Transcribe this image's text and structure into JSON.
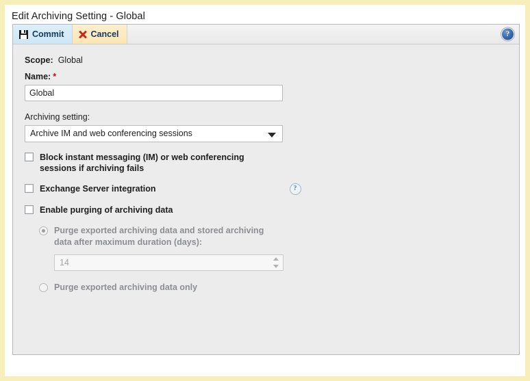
{
  "window": {
    "title": "Edit Archiving Setting - Global"
  },
  "toolbar": {
    "commit_label": "Commit",
    "cancel_label": "Cancel",
    "help_glyph": "?",
    "commit_icon": "save-icon",
    "cancel_icon": "close-x-icon"
  },
  "form": {
    "scope_label": "Scope:",
    "scope_value": "Global",
    "name_label": "Name:",
    "name_required_marker": "*",
    "name_value": "Global",
    "archiving_label": "Archiving setting:",
    "archiving_selected": "Archive IM and web conferencing sessions",
    "archiving_options": [
      "Archive IM and web conferencing sessions"
    ],
    "checkbox_block": {
      "label": "Block instant messaging (IM) or web conferencing sessions if archiving fails",
      "checked": false
    },
    "checkbox_exchange": {
      "label": "Exchange Server integration",
      "checked": false,
      "help_glyph": "?"
    },
    "checkbox_purging": {
      "label": "Enable purging of archiving data",
      "checked": false
    },
    "radio_purge_duration": {
      "label": "Purge exported archiving data and stored archiving data after maximum duration (days):",
      "selected": true,
      "disabled": true
    },
    "duration_input": {
      "value": "14",
      "disabled": true
    },
    "radio_purge_exported_only": {
      "label": "Purge exported archiving data only",
      "selected": false,
      "disabled": true
    }
  },
  "colors": {
    "frame": "#f7eeb9",
    "panel_bg": "#ececed",
    "commit_bg": "#cde7f8",
    "cancel_bg": "#fbe6b4",
    "toolbar_text": "#16385c",
    "required_star": "#d0021b",
    "help_blue": "#3d6cb0",
    "disabled_text": "#8c8e91"
  }
}
